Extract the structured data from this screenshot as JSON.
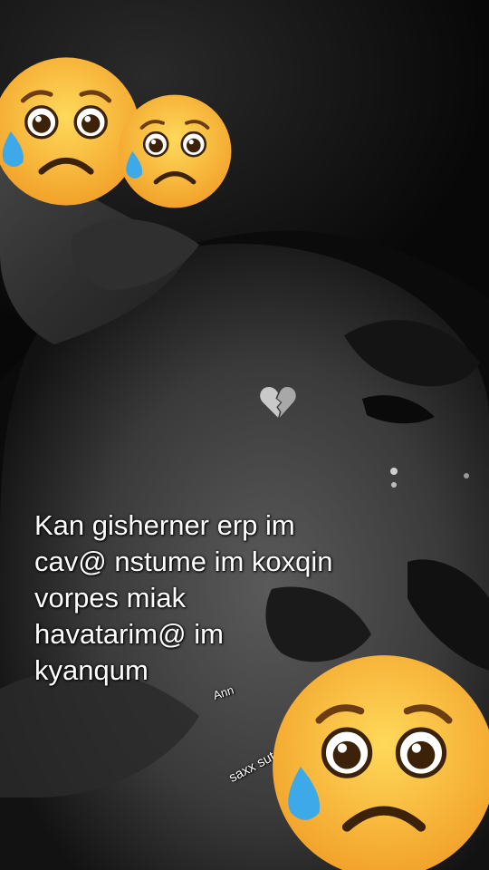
{
  "caption": {
    "lines": [
      "Kan gisherner erp im",
      "cav@ nstume im koxqin",
      "vorpes miak",
      "havatarim@ im",
      "kyanqum"
    ]
  },
  "tags": {
    "ann": "Ann",
    "saxx": "saxx sutaa"
  },
  "icons": {
    "sad_face": "sad-crying-face-emoji",
    "broken_heart": "broken-heart-emoji"
  },
  "colors": {
    "emoji_yellow": "#F7B52A",
    "tear_blue": "#3DA9E8",
    "background": "#0b0b0b"
  }
}
